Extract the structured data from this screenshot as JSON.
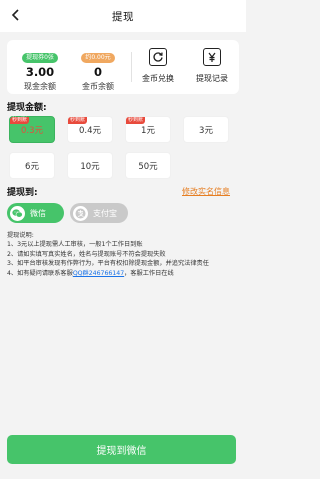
{
  "header": {
    "title": "提现"
  },
  "balances": {
    "cash": {
      "tag": "提现券0张",
      "value": "3.00",
      "label": "现金余额",
      "tag_color": "#46c46a"
    },
    "coin": {
      "tag": "约0.00元",
      "value": "0",
      "label": "金币余额",
      "tag_color": "#f0a860"
    }
  },
  "actions": [
    {
      "label": "金币兑换",
      "icon": "refresh-icon"
    },
    {
      "label": "提现记录",
      "icon": "yen-icon"
    }
  ],
  "amount": {
    "label": "提现金额:",
    "badge": "秒到账",
    "options": [
      {
        "label": "0.3元",
        "selected": true,
        "badge": true
      },
      {
        "label": "0.4元",
        "selected": false,
        "badge": true
      },
      {
        "label": "1元",
        "selected": false,
        "badge": true
      },
      {
        "label": "3元",
        "selected": false,
        "badge": false
      },
      {
        "label": "6元",
        "selected": false,
        "badge": false
      },
      {
        "label": "10元",
        "selected": false,
        "badge": false
      },
      {
        "label": "50元",
        "selected": false,
        "badge": false
      }
    ]
  },
  "withdraw_to": {
    "label": "提现到:",
    "modify_link": "修改实名信息",
    "methods": [
      {
        "label": "微信",
        "icon": "wechat-icon",
        "selected": true,
        "color": "#46c46a"
      },
      {
        "label": "支付宝",
        "icon": "alipay-icon",
        "selected": false,
        "color": "#c8c8c8"
      }
    ]
  },
  "notes": {
    "title": "提现说明:",
    "line1": "1、3元以上提现需人工审核，一般1个工作日到账",
    "line2": "2、请如实填写真实姓名，姓名与提现账号不符会提现失败",
    "line3": "3、如平台审核发现有作弊行为，平台有权扣除提现金额，并追究法律责任",
    "line4_pre": "4、如有疑问请联系客服",
    "line4_qq": "QQ群246766147",
    "line4_post": "，客服工作日在线"
  },
  "submit": {
    "label": "提现到微信"
  }
}
